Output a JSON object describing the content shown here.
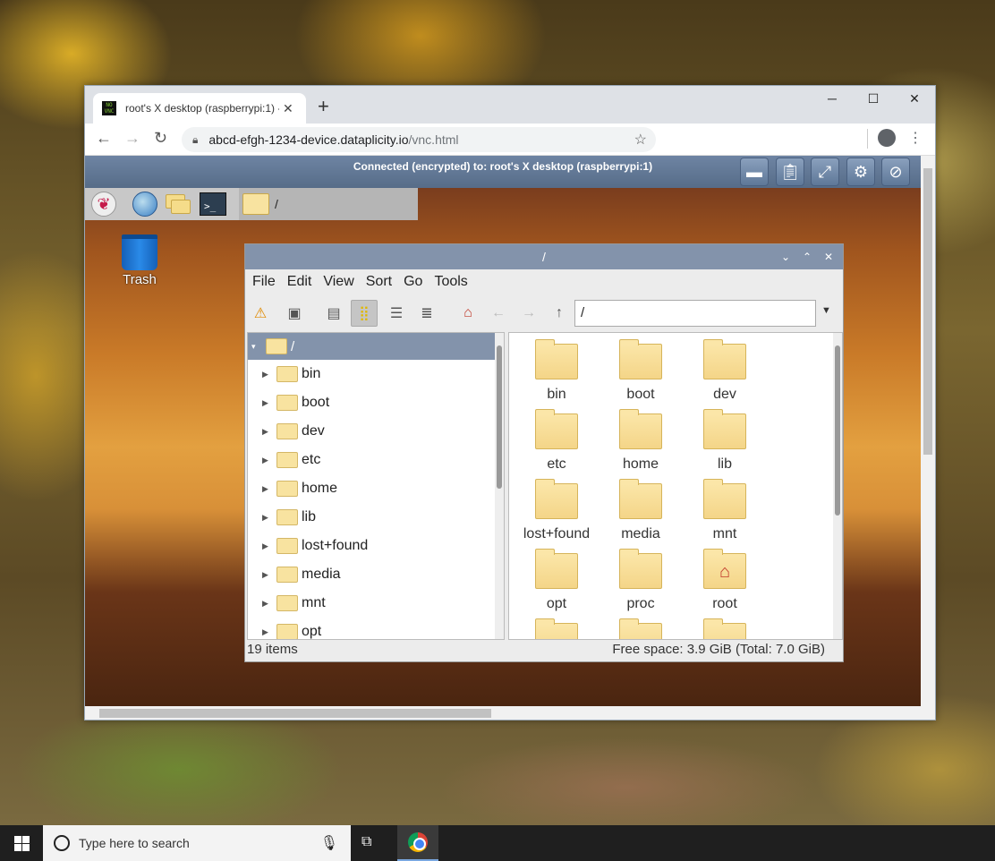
{
  "browser": {
    "tab_title": "root's X desktop (raspberrypi:1) -",
    "tab_favicon_text": "NO\nVNC",
    "new_tab": "+",
    "close_tab": "✕",
    "url_host": "abcd-efgh-1234-device.dataplicity.io",
    "url_path": "/vnc.html",
    "back": "←",
    "forward": "→",
    "reload": "↻",
    "star": "☆",
    "menu": "⋮",
    "minimize": "─",
    "maximize": "☐",
    "close": "✕"
  },
  "novnc": {
    "status": "Connected (encrypted) to: root's X desktop (raspberrypi:1)",
    "buttons": [
      "keyboard-icon",
      "clipboard-icon",
      "fullscreen-icon",
      "settings-icon",
      "disconnect-icon"
    ]
  },
  "rpi_panel": {
    "task_label": "/",
    "terminal_glyph": ">_"
  },
  "desktop": {
    "trash_label": "Trash"
  },
  "file_manager": {
    "title": "/",
    "menu": [
      "File",
      "Edit",
      "View",
      "Sort",
      "Go",
      "Tools"
    ],
    "path": "/",
    "tree_root": "/",
    "tree_items": [
      "bin",
      "boot",
      "dev",
      "etc",
      "home",
      "lib",
      "lost+found",
      "media",
      "mnt",
      "opt"
    ],
    "grid_items": [
      "bin",
      "boot",
      "dev",
      "etc",
      "home",
      "lib",
      "lost+found",
      "media",
      "mnt",
      "opt",
      "proc",
      "root"
    ],
    "item_count": "19 items",
    "free_space": "Free space: 3.9 GiB (Total: 7.0 GiB)"
  },
  "taskbar": {
    "search_placeholder": "Type here to search"
  }
}
